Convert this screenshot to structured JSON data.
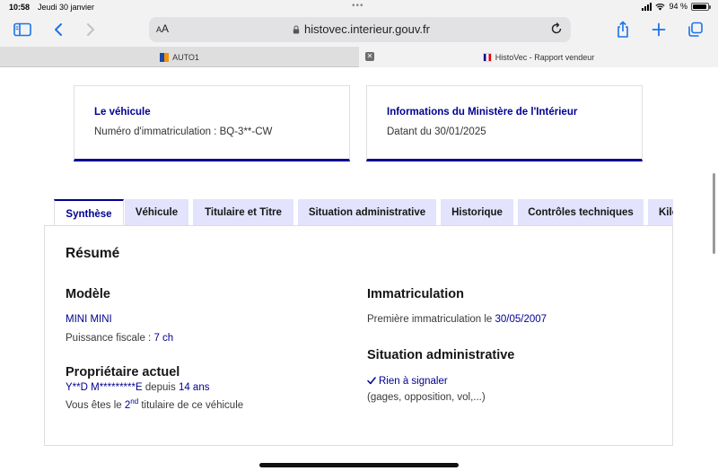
{
  "status_bar": {
    "time": "10:58",
    "date": "Jeudi 30 janvier",
    "battery": "94 %",
    "battery_level": 0.94
  },
  "browser": {
    "text_size_label_small": "A",
    "text_size_label_large": "A",
    "url": "histovec.interieur.gouv.fr",
    "tabs": [
      {
        "title": "AUTO1"
      },
      {
        "title": "HistoVec - Rapport vendeur"
      }
    ],
    "close_glyph": "✕"
  },
  "cards": [
    {
      "title": "Le véhicule",
      "text": "Numéro d'immatriculation : BQ-3**-CW"
    },
    {
      "title": "Informations du Ministère de l'Intérieur",
      "text": "Datant du 30/01/2025"
    }
  ],
  "tabs": [
    "Synthèse",
    "Véhicule",
    "Titulaire et Titre",
    "Situation administrative",
    "Historique",
    "Contrôles techniques",
    "Kilo"
  ],
  "summary": {
    "title": "Résumé",
    "model": {
      "title": "Modèle",
      "name": "MINI MINI",
      "power_label": "Puissance fiscale : ",
      "power_value": "7 ch"
    },
    "owner": {
      "title": "Propriétaire actuel",
      "name": "Y**D M*********E",
      "since_label": " depuis ",
      "duration": "14 ans",
      "rank_prefix": "Vous êtes le ",
      "rank_number": "2",
      "rank_suffix": "nd",
      "rank_rest": " titulaire de ce véhicule"
    },
    "registration": {
      "title": "Immatriculation",
      "first_label": "Première immatriculation le ",
      "first_date": "30/05/2007"
    },
    "admin": {
      "title": "Situation administrative",
      "status": "Rien à signaler",
      "details": "(gages, opposition, vol,...)"
    }
  },
  "colors": {
    "accent": "#000091",
    "tab_bg": "#e3e3fd",
    "ios_blue": "#1a73e8"
  }
}
